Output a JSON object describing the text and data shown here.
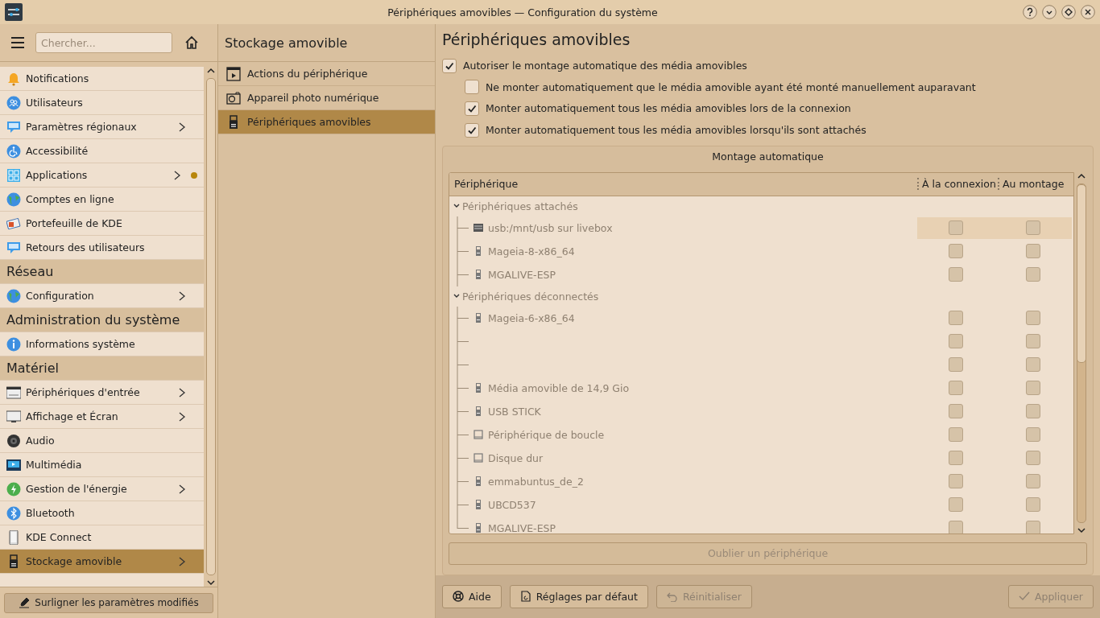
{
  "window": {
    "title": "Périphériques amovibles — Configuration du système"
  },
  "search": {
    "placeholder": "Chercher..."
  },
  "sidebar": {
    "items": [
      {
        "kind": "item",
        "label": "Notifications",
        "expandable": false,
        "modified": false,
        "selected": false
      },
      {
        "kind": "item",
        "label": "Utilisateurs",
        "expandable": false,
        "modified": false,
        "selected": false
      },
      {
        "kind": "item",
        "label": "Paramètres régionaux",
        "expandable": true,
        "modified": false,
        "selected": false
      },
      {
        "kind": "item",
        "label": "Accessibilité",
        "expandable": false,
        "modified": false,
        "selected": false
      },
      {
        "kind": "item",
        "label": "Applications",
        "expandable": true,
        "modified": true,
        "selected": false
      },
      {
        "kind": "item",
        "label": "Comptes en ligne",
        "expandable": false,
        "modified": false,
        "selected": false
      },
      {
        "kind": "item",
        "label": "Portefeuille de KDE",
        "expandable": false,
        "modified": false,
        "selected": false
      },
      {
        "kind": "item",
        "label": "Retours des utilisateurs",
        "expandable": false,
        "modified": false,
        "selected": false
      },
      {
        "kind": "header",
        "label": "Réseau"
      },
      {
        "kind": "item",
        "label": "Configuration",
        "expandable": true,
        "modified": false,
        "selected": false
      },
      {
        "kind": "header",
        "label": "Administration du système"
      },
      {
        "kind": "item",
        "label": "Informations système",
        "expandable": false,
        "modified": false,
        "selected": false
      },
      {
        "kind": "header",
        "label": "Matériel"
      },
      {
        "kind": "item",
        "label": "Périphériques d'entrée",
        "expandable": true,
        "modified": false,
        "selected": false
      },
      {
        "kind": "item",
        "label": "Affichage et Écran",
        "expandable": true,
        "modified": false,
        "selected": false
      },
      {
        "kind": "item",
        "label": "Audio",
        "expandable": false,
        "modified": false,
        "selected": false
      },
      {
        "kind": "item",
        "label": "Multimédia",
        "expandable": false,
        "modified": false,
        "selected": false
      },
      {
        "kind": "item",
        "label": "Gestion de l'énergie",
        "expandable": true,
        "modified": false,
        "selected": false
      },
      {
        "kind": "item",
        "label": "Bluetooth",
        "expandable": false,
        "modified": false,
        "selected": false
      },
      {
        "kind": "item",
        "label": "KDE Connect",
        "expandable": false,
        "modified": false,
        "selected": false
      },
      {
        "kind": "item",
        "label": "Stockage amovible",
        "expandable": true,
        "modified": false,
        "selected": true
      }
    ],
    "footer_button": "Surligner les paramètres modifiés"
  },
  "subpanel": {
    "title": "Stockage amovible",
    "items": [
      {
        "label": "Actions du périphérique",
        "selected": false
      },
      {
        "label": "Appareil photo numérique",
        "selected": false
      },
      {
        "label": "Périphériques amovibles",
        "selected": true
      }
    ]
  },
  "page": {
    "title": "Périphériques amovibles",
    "options": [
      {
        "label": "Autoriser le montage automatique des média amovibles",
        "checked": true,
        "children": [
          {
            "label": "Ne monter automatiquement que le média amovible ayant été monté manuellement auparavant",
            "checked": false
          },
          {
            "label": "Monter automatiquement tous les média amovibles lors de la connexion",
            "checked": true
          },
          {
            "label": "Monter automatiquement tous les média amovibles lorsqu'ils sont attachés",
            "checked": true
          }
        ]
      }
    ],
    "group_title": "Montage automatique",
    "table": {
      "columns": [
        "Périphérique",
        "À la connexion",
        "Au montage"
      ],
      "groups": [
        {
          "label": "Périphériques attachés",
          "expanded": true,
          "children": [
            {
              "kind": "drive",
              "name": "usb:/mnt/usb sur livebox",
              "selected": true,
              "on_login": false,
              "on_attach": false
            },
            {
              "kind": "usb",
              "name": "Mageia-8-x86_64",
              "selected": false,
              "on_login": false,
              "on_attach": false
            },
            {
              "kind": "usb",
              "name": "MGALIVE-ESP",
              "selected": false,
              "on_login": false,
              "on_attach": false
            }
          ]
        },
        {
          "label": "Périphériques déconnectés",
          "expanded": true,
          "children": [
            {
              "kind": "usb",
              "name": "Mageia-6-x86_64",
              "selected": false,
              "on_login": false,
              "on_attach": false
            },
            {
              "kind": "none",
              "selected": false,
              "on_login": false,
              "on_attach": false
            },
            {
              "kind": "none",
              "selected": false,
              "on_login": false,
              "on_attach": false
            },
            {
              "kind": "usb",
              "name": "Média amovible de 14,9 Gio",
              "selected": false,
              "on_login": false,
              "on_attach": false
            },
            {
              "kind": "usb",
              "name": "USB STICK",
              "selected": false,
              "on_login": false,
              "on_attach": false
            },
            {
              "kind": "disk",
              "name": "Périphérique de boucle",
              "selected": false,
              "on_login": false,
              "on_attach": false
            },
            {
              "kind": "disk",
              "name": "Disque dur",
              "selected": false,
              "on_login": false,
              "on_attach": false
            },
            {
              "kind": "usb",
              "name": "emmabuntus_de_2",
              "selected": false,
              "on_login": false,
              "on_attach": false
            },
            {
              "kind": "usb",
              "name": "UBCD537",
              "selected": false,
              "on_login": false,
              "on_attach": false
            },
            {
              "kind": "usb",
              "name": "MGALIVE-ESP",
              "selected": false,
              "on_login": false,
              "on_attach": false
            }
          ]
        }
      ]
    },
    "forget_button": {
      "label": "Oublier un périphérique",
      "disabled": true
    }
  },
  "buttons": [
    {
      "kind": "help",
      "label": "Aide",
      "disabled": false
    },
    {
      "kind": "defaults",
      "label": "Réglages par défaut",
      "disabled": false
    },
    {
      "kind": "reset",
      "label": "Réinitialiser",
      "disabled": true
    },
    {
      "kind": "apply",
      "label": "Appliquer",
      "disabled": true
    }
  ]
}
